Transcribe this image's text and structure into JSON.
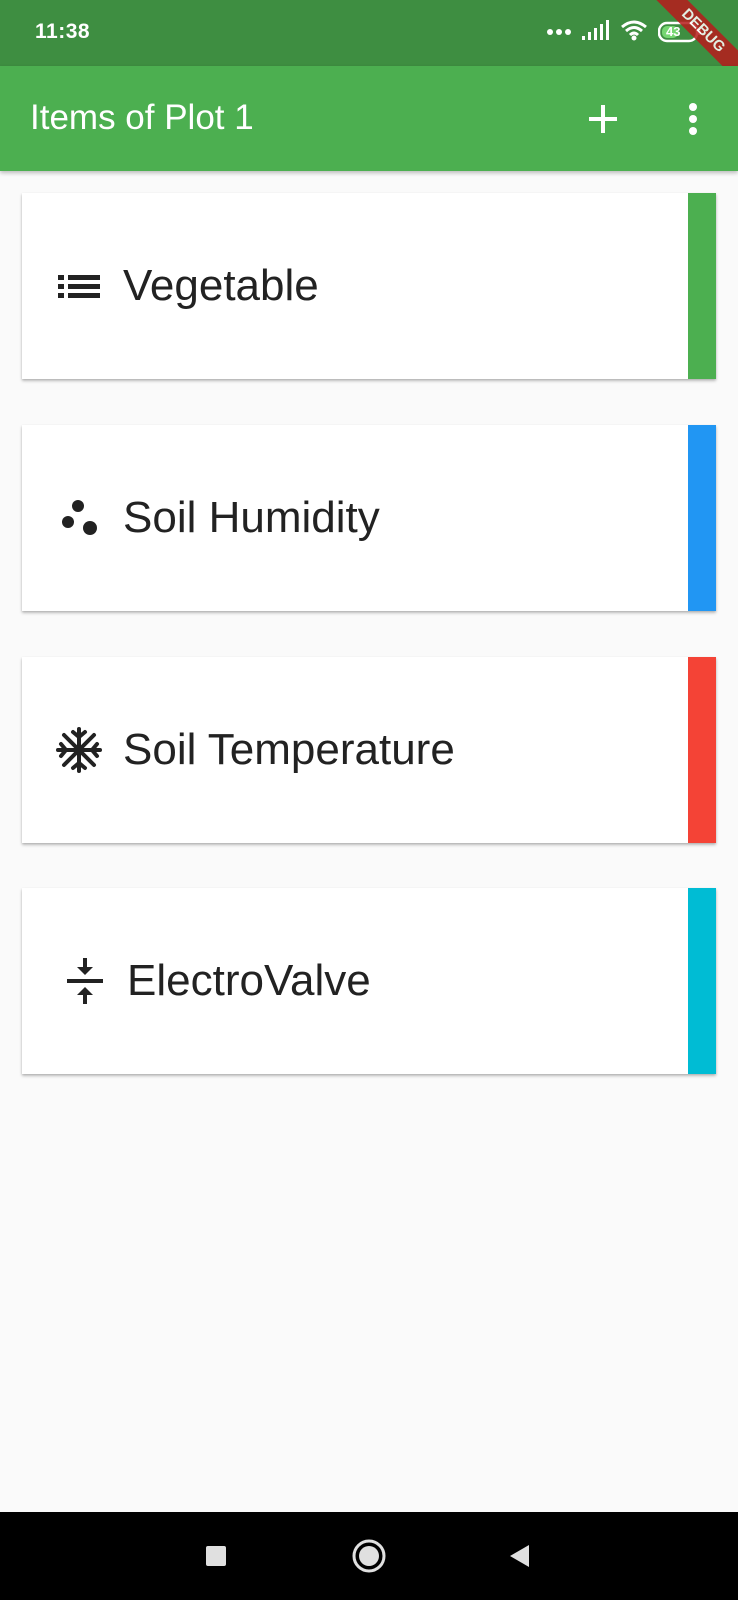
{
  "status_bar": {
    "time": "11:38",
    "battery": "43",
    "debug_label": "DEBUG",
    "icons": [
      "more-dots-icon",
      "signal-icon",
      "wifi-icon",
      "battery-icon"
    ]
  },
  "app_bar": {
    "title": "Items of Plot 1",
    "actions": [
      "add-icon",
      "more-vert-icon"
    ],
    "color": "#4caf50"
  },
  "items": [
    {
      "label": "Vegetable",
      "icon": "list-icon",
      "accent": "#4caf50"
    },
    {
      "label": "Soil Humidity",
      "icon": "dots-icon",
      "accent": "#2196f3"
    },
    {
      "label": "Soil Temperature",
      "icon": "snowflake-icon",
      "accent": "#f44336"
    },
    {
      "label": "ElectroValve",
      "icon": "compress-icon",
      "accent": "#00bcd4"
    }
  ],
  "nav_bar": {
    "icons": [
      "recents-square-icon",
      "home-circle-icon",
      "back-triangle-icon"
    ]
  }
}
